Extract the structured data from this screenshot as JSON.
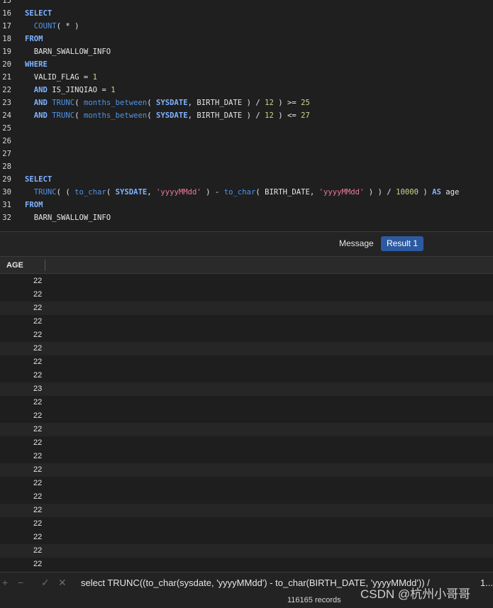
{
  "editor": {
    "lines": [
      {
        "num": "15",
        "tokens": []
      },
      {
        "num": "16",
        "tokens": [
          {
            "t": "SELECT",
            "c": "kw"
          }
        ]
      },
      {
        "num": "17",
        "tokens": [
          {
            "t": "  "
          },
          {
            "t": "COUNT",
            "c": "fn"
          },
          {
            "t": "( * )"
          }
        ]
      },
      {
        "num": "18",
        "tokens": [
          {
            "t": "FROM",
            "c": "kw"
          }
        ]
      },
      {
        "num": "19",
        "tokens": [
          {
            "t": "  BARN_SWALLOW_INFO"
          }
        ]
      },
      {
        "num": "20",
        "tokens": [
          {
            "t": "WHERE",
            "c": "kw"
          }
        ]
      },
      {
        "num": "21",
        "tokens": [
          {
            "t": "  VALID_FLAG = "
          },
          {
            "t": "1",
            "c": "num"
          }
        ]
      },
      {
        "num": "22",
        "tokens": [
          {
            "t": "  "
          },
          {
            "t": "AND",
            "c": "kw"
          },
          {
            "t": " IS_JINQIAO = "
          },
          {
            "t": "1",
            "c": "num"
          }
        ]
      },
      {
        "num": "23",
        "tokens": [
          {
            "t": "  "
          },
          {
            "t": "AND",
            "c": "kw"
          },
          {
            "t": " "
          },
          {
            "t": "TRUNC",
            "c": "fn"
          },
          {
            "t": "( "
          },
          {
            "t": "months_between",
            "c": "fn"
          },
          {
            "t": "( "
          },
          {
            "t": "SYSDATE",
            "c": "kw"
          },
          {
            "t": ", BIRTH_DATE ) / "
          },
          {
            "t": "12",
            "c": "num"
          },
          {
            "t": " ) >= "
          },
          {
            "t": "25",
            "c": "num"
          }
        ]
      },
      {
        "num": "24",
        "tokens": [
          {
            "t": "  "
          },
          {
            "t": "AND",
            "c": "kw"
          },
          {
            "t": " "
          },
          {
            "t": "TRUNC",
            "c": "fn"
          },
          {
            "t": "( "
          },
          {
            "t": "months_between",
            "c": "fn"
          },
          {
            "t": "( "
          },
          {
            "t": "SYSDATE",
            "c": "kw"
          },
          {
            "t": ", BIRTH_DATE ) / "
          },
          {
            "t": "12",
            "c": "num"
          },
          {
            "t": " ) <= "
          },
          {
            "t": "27",
            "c": "num"
          }
        ]
      },
      {
        "num": "25",
        "tokens": []
      },
      {
        "num": "26",
        "tokens": []
      },
      {
        "num": "27",
        "tokens": []
      },
      {
        "num": "28",
        "tokens": []
      },
      {
        "num": "29",
        "tokens": [
          {
            "t": "SELECT",
            "c": "kw"
          }
        ]
      },
      {
        "num": "30",
        "tokens": [
          {
            "t": "  "
          },
          {
            "t": "TRUNC",
            "c": "fn"
          },
          {
            "t": "( ( "
          },
          {
            "t": "to_char",
            "c": "fn"
          },
          {
            "t": "( "
          },
          {
            "t": "SYSDATE",
            "c": "kw"
          },
          {
            "t": ", "
          },
          {
            "t": "'yyyyMMdd'",
            "c": "str"
          },
          {
            "t": " ) - "
          },
          {
            "t": "to_char",
            "c": "fn"
          },
          {
            "t": "( BIRTH_DATE, "
          },
          {
            "t": "'yyyyMMdd'",
            "c": "str"
          },
          {
            "t": " ) ) / "
          },
          {
            "t": "10000",
            "c": "num"
          },
          {
            "t": " ) "
          },
          {
            "t": "AS",
            "c": "kw"
          },
          {
            "t": " age"
          }
        ]
      },
      {
        "num": "31",
        "tokens": [
          {
            "t": "FROM",
            "c": "kw"
          }
        ]
      },
      {
        "num": "32",
        "tokens": [
          {
            "t": "  BARN_SWALLOW_INFO"
          }
        ]
      }
    ]
  },
  "tabs": {
    "message": "Message",
    "result": "Result 1"
  },
  "grid": {
    "column_header": "AGE",
    "rows": [
      "22",
      "22",
      "22",
      "22",
      "22",
      "22",
      "22",
      "22",
      "23",
      "22",
      "22",
      "22",
      "22",
      "22",
      "22",
      "22",
      "22",
      "22",
      "22",
      "22",
      "22",
      "22"
    ]
  },
  "bottom": {
    "sql_status": "select TRUNC((to_char(sysdate, 'yyyyMMdd') - to_char(BIRTH_DATE, 'yyyyMMdd')) /",
    "truncated": "1...",
    "records": "116165 records",
    "watermark": "CSDN @杭州小哥哥",
    "tools": [
      {
        "name": "add-row-icon",
        "glyph": "+"
      },
      {
        "name": "delete-row-icon",
        "glyph": "−"
      },
      {
        "name": "apply-icon",
        "glyph": "✓"
      },
      {
        "name": "discard-icon",
        "glyph": "✕"
      }
    ]
  }
}
